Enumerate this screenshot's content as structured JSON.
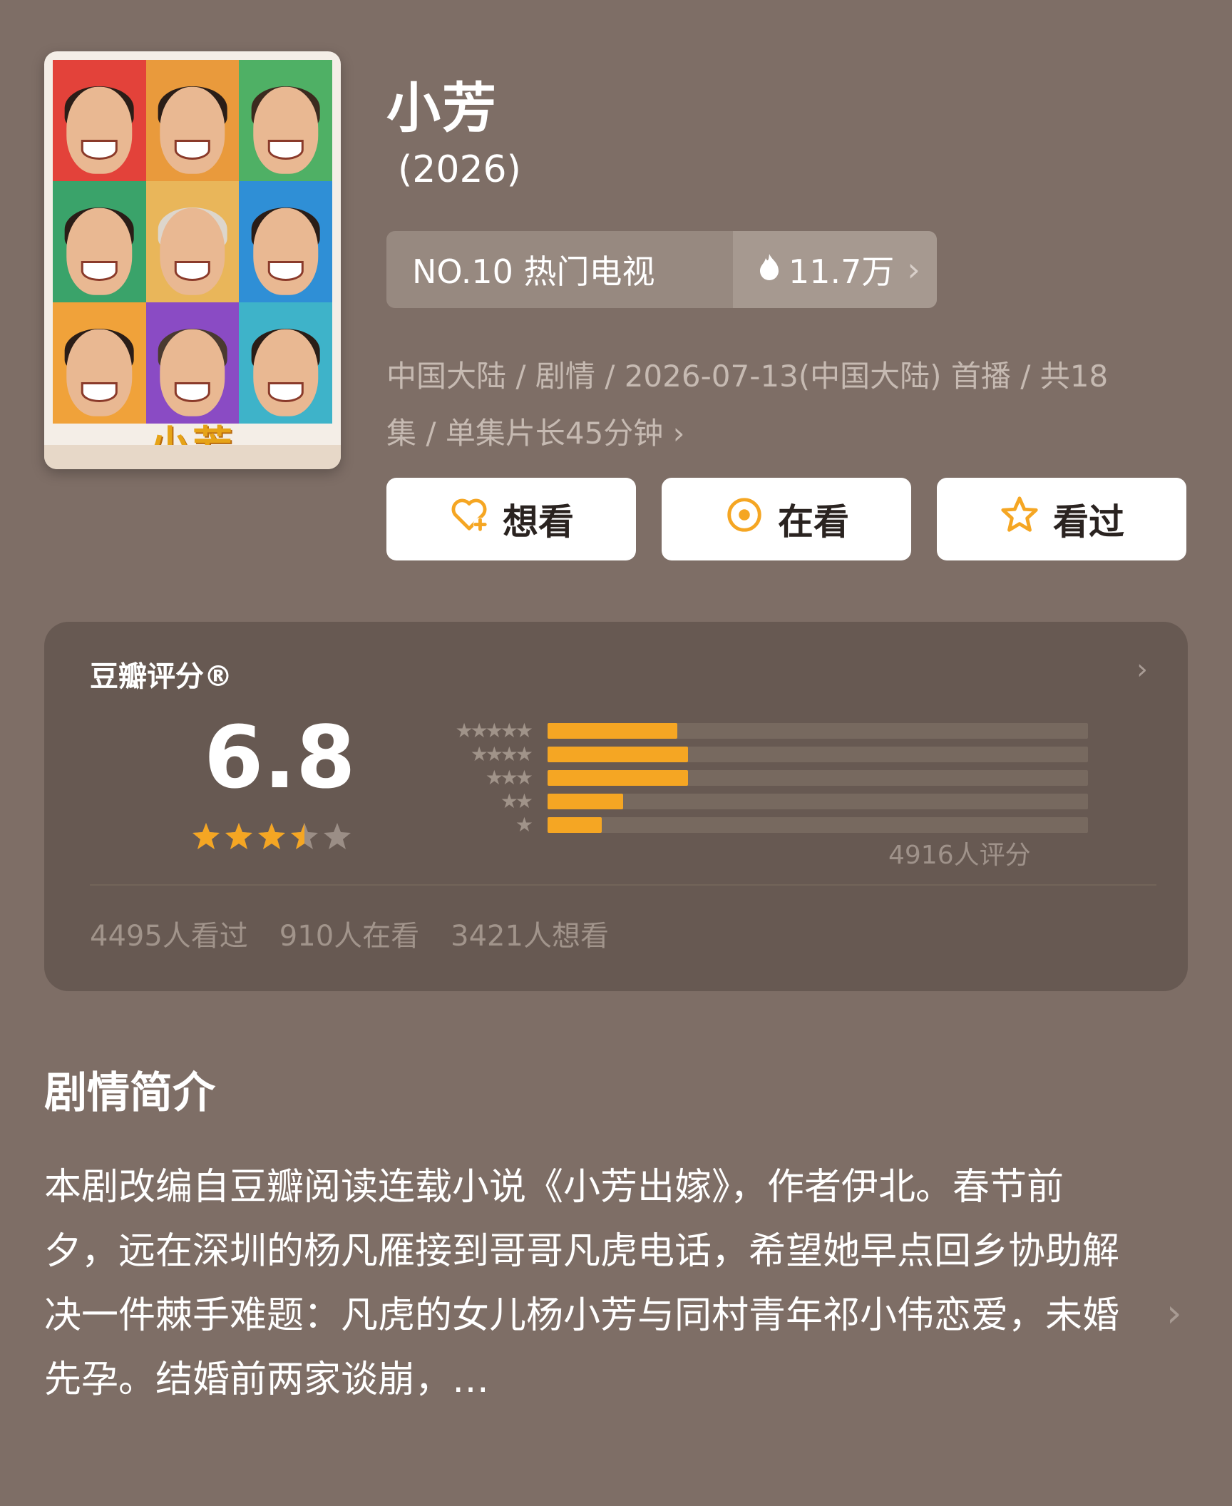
{
  "show": {
    "title": "小芳",
    "year": "(2026)",
    "rank": "NO.10 热门电视",
    "heat": "11.7万",
    "meta_line1": "中国大陆 / 剧情 / 2026-07-13(中国大陆) 首播 / 共18",
    "meta_line2": "集 / 单集片长45分钟",
    "poster_title": "小芳"
  },
  "actions": {
    "want": "想看",
    "watching": "在看",
    "watched": "看过"
  },
  "rating": {
    "label": "豆瓣评分®",
    "score": "6.8",
    "stars": 3.5,
    "distribution": [
      {
        "stars": 5,
        "pct": 24
      },
      {
        "stars": 4,
        "pct": 26
      },
      {
        "stars": 3,
        "pct": 26
      },
      {
        "stars": 2,
        "pct": 14
      },
      {
        "stars": 1,
        "pct": 10
      }
    ],
    "count": "4916人评分",
    "watched": "4495人看过",
    "watching": "910人在看",
    "want": "3421人想看"
  },
  "synopsis": {
    "title": "剧情简介",
    "text": "本剧改编自豆瓣阅读连载小说《小芳出嫁》，作者伊北。春节前夕，远在深圳的杨凡雁接到哥哥凡虎电话，希望她早点回乡协助解决一件棘手难题：凡虎的女儿杨小芳与同村青年祁小伟恋爱，未婚先孕。结婚前两家谈崩，…"
  },
  "colors": {
    "background": "#7e6e66",
    "card": "#675952",
    "accent": "#f5a623"
  },
  "icons": {
    "heat": "flame-icon",
    "want": "heart-plus-icon",
    "watching": "target-icon",
    "watched": "star-outline-icon"
  }
}
